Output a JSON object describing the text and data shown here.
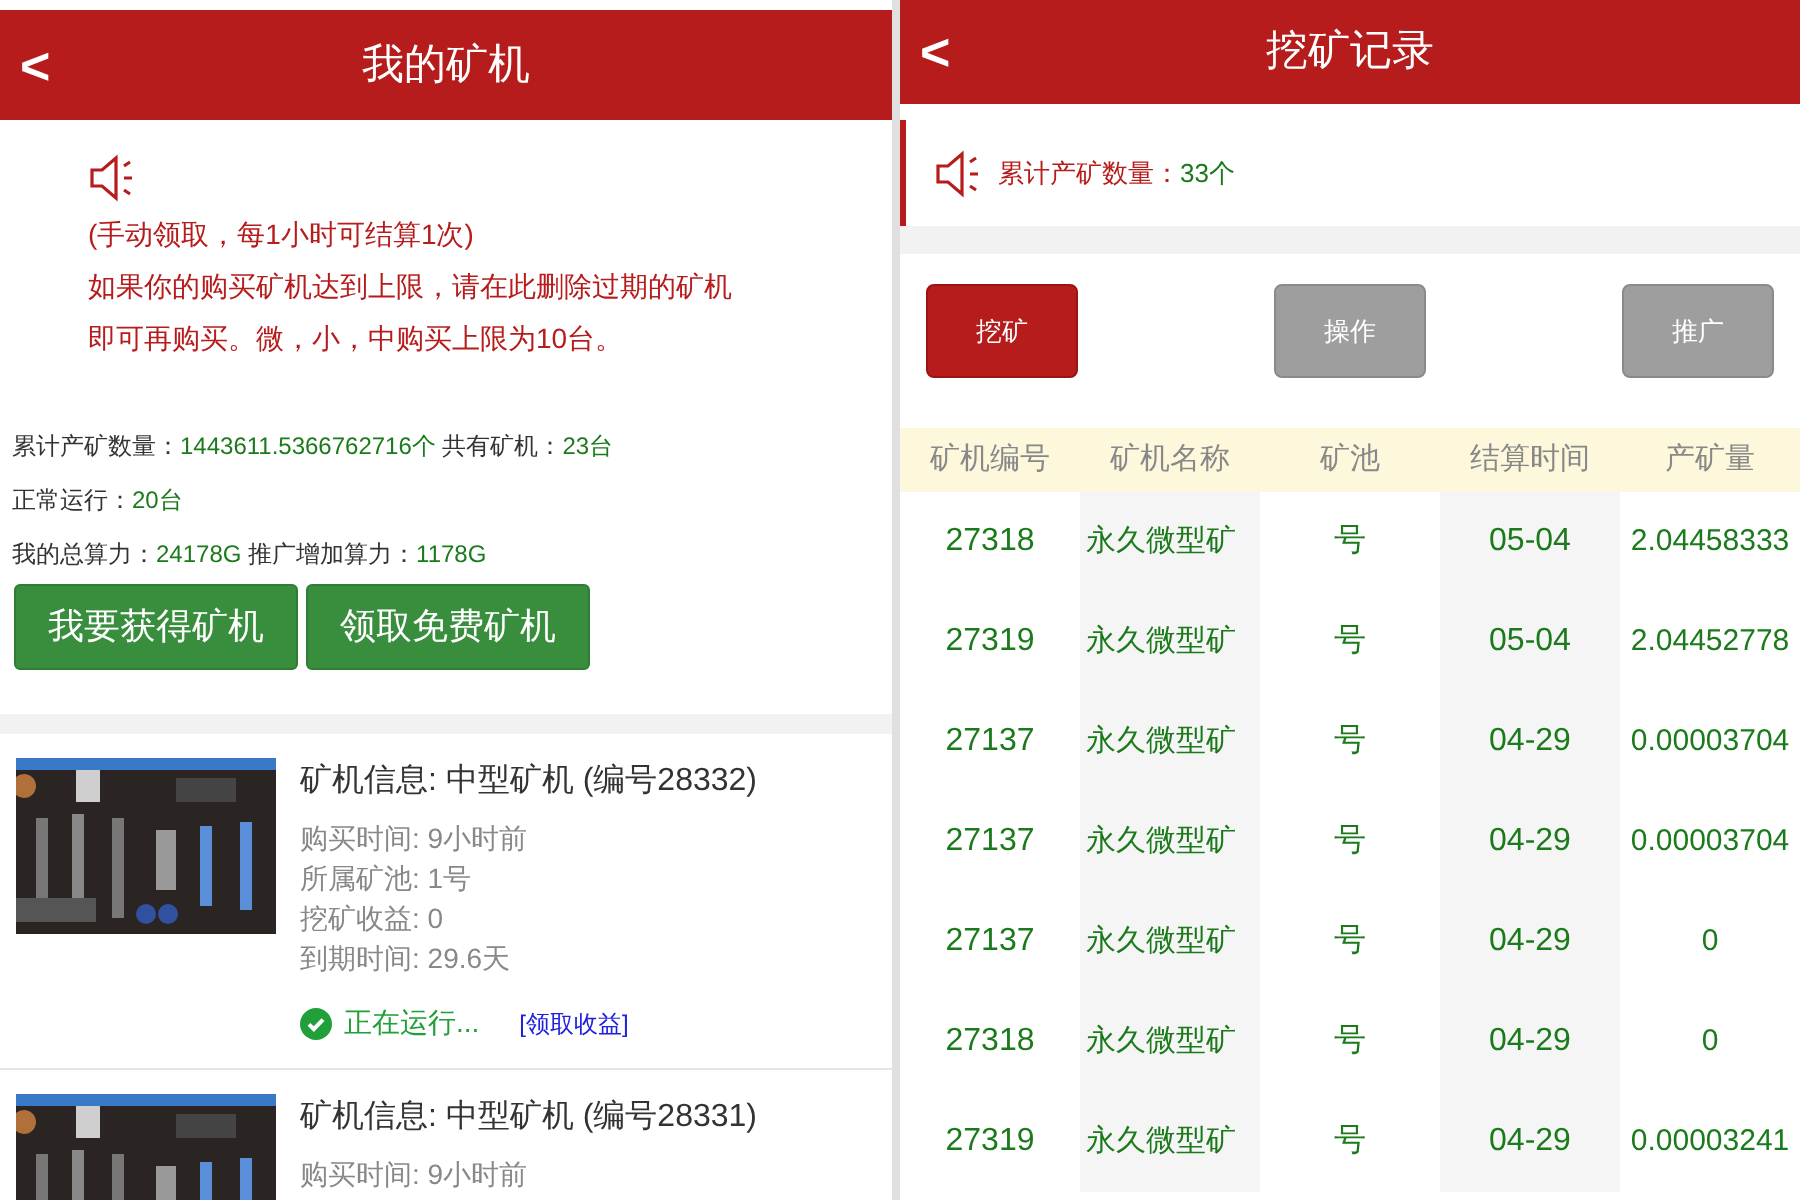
{
  "left": {
    "header": {
      "back": "<",
      "title": "我的矿机"
    },
    "notice": {
      "lines": [
        "(手动领取，每1小时可结算1次)",
        "如果你的购买矿机达到上限，请在此删除过期的矿机",
        "即可再购买。微，小，中购买上限为10台。"
      ]
    },
    "stats": [
      [
        {
          "label": "累计产矿数量：",
          "value": "1443611.5366762716个"
        },
        {
          "label": " 共有矿机：",
          "value": "23台"
        }
      ],
      [
        {
          "label": "正常运行：",
          "value": "20台"
        }
      ],
      [
        {
          "label": "我的总算力：",
          "value": "24178G"
        },
        {
          "label": " 推广增加算力：",
          "value": "1178G"
        }
      ]
    ],
    "buttons": [
      "我要获得矿机",
      "领取免费矿机"
    ],
    "machines": [
      {
        "title": "矿机信息: 中型矿机 (编号28332)",
        "details": [
          "购买时间: 9小时前",
          "所属矿池: 1号",
          "挖矿收益: 0",
          "到期时间: 29.6天"
        ],
        "status": "正在运行...",
        "running": true,
        "action": "[领取收益]"
      },
      {
        "title": "矿机信息: 中型矿机 (编号28331)",
        "details": [
          "购买时间: 9小时前"
        ]
      }
    ]
  },
  "right": {
    "header": {
      "back": "<",
      "title": "挖矿记录"
    },
    "notice": {
      "label": "累计产矿数量：",
      "value": "33个"
    },
    "tabs": [
      {
        "label": "挖矿",
        "selected": true
      },
      {
        "label": "操作",
        "selected": false
      },
      {
        "label": "推广",
        "selected": false
      }
    ],
    "table": {
      "columns": [
        "矿机编号",
        "矿机名称",
        "矿池",
        "结算时间",
        "产矿量"
      ],
      "rows": [
        [
          "27318",
          "永久微型矿",
          "号",
          "05-04",
          "2.04458333"
        ],
        [
          "27319",
          "永久微型矿",
          "号",
          "05-04",
          "2.04452778"
        ],
        [
          "27137",
          "永久微型矿",
          "号",
          "04-29",
          "0.00003704"
        ],
        [
          "27137",
          "永久微型矿",
          "号",
          "04-29",
          "0.00003704"
        ],
        [
          "27137",
          "永久微型矿",
          "号",
          "04-29",
          "0"
        ],
        [
          "27318",
          "永久微型矿",
          "号",
          "04-29",
          "0"
        ],
        [
          "27319",
          "永久微型矿",
          "号",
          "04-29",
          "0.00003241"
        ]
      ]
    }
  }
}
